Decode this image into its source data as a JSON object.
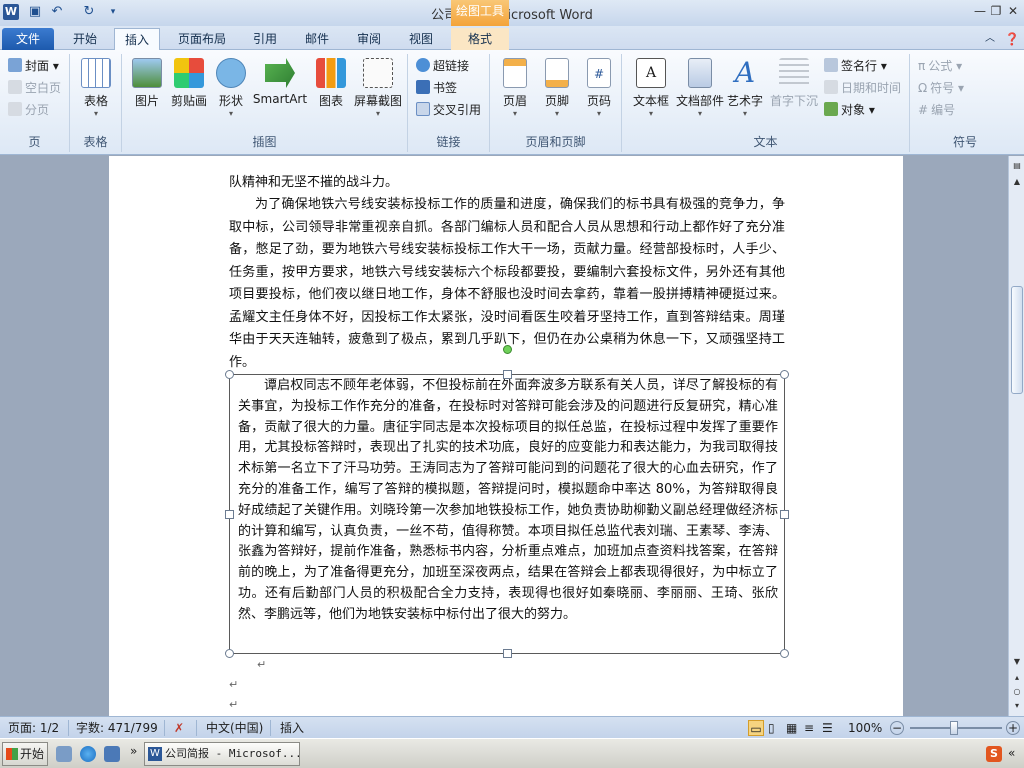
{
  "app": {
    "title": "公司简报 - Microsoft Word",
    "context_tab_group": "绘图工具",
    "word_icon": "W"
  },
  "qat": {
    "save_icon": "save-icon",
    "undo_icon": "undo-icon",
    "redo_icon": "redo-icon"
  },
  "window_controls": {
    "minimize": "—",
    "restore": "❐",
    "close": "✕"
  },
  "tabs": [
    {
      "label": "文件"
    },
    {
      "label": "开始"
    },
    {
      "label": "插入"
    },
    {
      "label": "页面布局"
    },
    {
      "label": "引用"
    },
    {
      "label": "邮件"
    },
    {
      "label": "审阅"
    },
    {
      "label": "视图"
    },
    {
      "label": "格式"
    }
  ],
  "ribbon": {
    "pages": {
      "label": "页",
      "items": [
        "封面",
        "空白页",
        "分页"
      ]
    },
    "tables": {
      "label": "表格",
      "items": [
        "表格"
      ]
    },
    "illustrations": {
      "label": "插图",
      "items": [
        "图片",
        "剪贴画",
        "形状",
        "SmartArt",
        "图表",
        "屏幕截图"
      ]
    },
    "links": {
      "label": "链接",
      "items": [
        "超链接",
        "书签",
        "交叉引用"
      ]
    },
    "header_footer": {
      "label": "页眉和页脚",
      "items": [
        "页眉",
        "页脚",
        "页码"
      ]
    },
    "text": {
      "label": "文本",
      "items": [
        "文本框",
        "文档部件",
        "艺术字",
        "首字下沉"
      ],
      "small": [
        "签名行",
        "日期和时间",
        "对象"
      ]
    },
    "symbols": {
      "label": "符号",
      "items": [
        "公式",
        "符号",
        "编号"
      ]
    }
  },
  "document": {
    "line0": "队精神和无坚不摧的战斗力。",
    "para1": "为了确保地铁六号线安装标投标工作的质量和进度，确保我们的标书具有极强的竞争力，争取中标，公司领导非常重视亲自抓。各部门编标人员和配合人员从思想和行动上都作好了充分准备，憋足了劲，要为地铁六号线安装标投标工作大干一场，贡献力量。经营部投标时，人手少、任务重，按甲方要求，地铁六号线安装标六个标段都要投，要编制六套投标文件，另外还有其他项目要投标，他们夜以继日地工作，身体不舒服也没时间去拿药，靠着一股拼搏精神硬挺过来。孟耀文主任身体不好，因投标工作太紧张，没时间看医生咬着牙坚持工作，直到答辩结束。周瑾华由于天天连轴转，疲惫到了极点，累到几乎趴下，但仍在办公桌稍为休息一下，又顽强坚持工作。",
    "textbox": "谭启权同志不顾年老体弱，不但投标前在外面奔波多方联系有关人员，详尽了解投标的有关事宜，为投标工作作充分的准备，在投标时对答辩可能会涉及的问题进行反复研究，精心准备，贡献了很大的力量。唐征宇同志是本次投标项目的拟任总监，在投标过程中发挥了重要作用，尤其投标答辩时，表现出了扎实的技术功底，良好的应变能力和表达能力，为我司取得技术标第一名立下了汗马功劳。王涛同志为了答辩可能问到的问题花了很大的心血去研究，作了充分的准备工作，编写了答辩的模拟题，答辩提问时，模拟题命中率达 80%，为答辩取得良好成绩起了关键作用。刘晓玲第一次参加地铁投标工作，她负责协助柳勤义副总经理做经济标的计算和编写，认真负责，一丝不苟，值得称赞。本项目拟任总监代表刘瑞、王素琴、李涛、张鑫为答辩好，提前作准备，熟悉标书内容，分析重点难点，加班加点查资料找答案，在答辩前的晚上，为了准备得更充分，加班至深夜两点，结果在答辩会上都表现得很好，为中标立了功。还有后勤部门人员的积极配合全力支持，表现得也很好如秦晓丽、李丽丽、王琦、张欣然、李鹏远等，他们为地铁安装标中标付出了很大的努力。",
    "pilcrow": "↵"
  },
  "status": {
    "page": "页面: 1/2",
    "words": "字数: 471/799",
    "language": "中文(中国)",
    "mode": "插入",
    "zoom": "100%",
    "zoom_minus": "−",
    "zoom_plus": "+"
  },
  "taskbar": {
    "start": "开始",
    "window_label": "公司简报 - Microsof...",
    "more": "»",
    "tray_chevron": "«"
  },
  "colors": {
    "accent": "#2b5797",
    "file_tab": "#1d5aad",
    "context_tab": "#f3a33a",
    "rotate_handle": "#6fd05a"
  }
}
